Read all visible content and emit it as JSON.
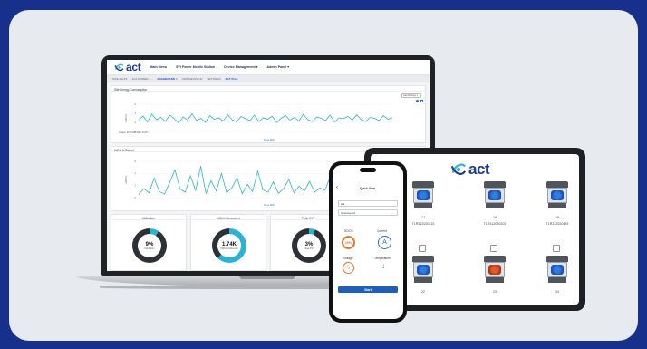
{
  "app": {
    "brand": "act"
  },
  "colors": {
    "background": "#16308c",
    "card": "#e7ebf0",
    "brand_blue": "#1b3b8f",
    "accent": "#2bb3d6",
    "gauge_orange": "#e9742b"
  },
  "laptop": {
    "nav": [
      "Main Menu",
      "SVI Power Mobile Station",
      "Device Management ▾",
      "Admin Panel ▾"
    ],
    "tabs": [
      "SITE-JALP1",
      "AC1 POWER 1...",
      "DASHBOARD ×",
      "UNIT/DEVICE ID",
      "SETTINGS",
      "ACT Prod"
    ],
    "panel1": {
      "title": "Site Energy Consumption",
      "range_label": "Last 30 Days ▾",
      "summary": "Status: 22.5 kWh/day, 8.4% ↑↑",
      "view_more": "View More"
    },
    "panel2": {
      "title": "kWh/Hz Output",
      "view_more": "View More"
    },
    "gauges": [
      {
        "title": "Utilization",
        "value": "9%",
        "label": "Utilization",
        "fraction": 0.09
      },
      {
        "title": "kWh/h Generated",
        "value": "1.74K",
        "label": "kWh/h Delivered",
        "fraction": 0.62
      },
      {
        "title": "Peak KVT",
        "value": "3%",
        "label": "Peak KVT",
        "fraction": 0.03
      }
    ]
  },
  "tablet": {
    "brand": "act",
    "units": [
      {
        "number": "17",
        "serial": "T1R312020415",
        "state": "ok"
      },
      {
        "number": "18",
        "serial": "T1R312020202",
        "state": "ok"
      },
      {
        "number": "19",
        "serial": "T1R312020429",
        "state": "ok"
      },
      {
        "number": "22",
        "serial": "",
        "state": "ok"
      },
      {
        "number": "23",
        "serial": "",
        "state": "error"
      },
      {
        "number": "24",
        "serial": "",
        "state": "ok"
      }
    ]
  },
  "phone": {
    "title": "Quick View",
    "field1": "HS",
    "field2": "Unoccupied",
    "metrics": [
      {
        "label": "SOC%",
        "value": "45%"
      },
      {
        "label": "Current",
        "value": "A"
      },
      {
        "label": "Voltage",
        "value": ""
      },
      {
        "label": "Temperature",
        "value": ""
      }
    ],
    "button": "Start"
  },
  "chart_data": [
    {
      "type": "line",
      "title": "Site Energy Consumption",
      "ylabel": "kWh/hr",
      "ylim": [
        0,
        6
      ],
      "series": [
        {
          "values": [
            2.5,
            3.4,
            2.1,
            3.8,
            2.6,
            3.1,
            2.2,
            3.6,
            2.8,
            1.9,
            3.2,
            2.5,
            3.9,
            2.4,
            2.9,
            2.0,
            3.5,
            2.7,
            3.0,
            2.3,
            3.7,
            2.6,
            2.1,
            3.3,
            2.8,
            2.4,
            3.6,
            2.2,
            3.0,
            2.7,
            3.4,
            2.0,
            2.9,
            3.5,
            2.5,
            3.1,
            2.3,
            3.8,
            2.6,
            2.2,
            3.2,
            2.9,
            2.4,
            3.6,
            2.1,
            3.0,
            2.8,
            3.3,
            2.5,
            3.7,
            2.6,
            2.2,
            3.1,
            2.9,
            2.4,
            3.5,
            2.7,
            3.0
          ]
        }
      ]
    },
    {
      "type": "line",
      "title": "kWh/Hz Output",
      "ylabel": "kWh/hr",
      "ylim": [
        0,
        6
      ],
      "series": [
        {
          "values": [
            0.5,
            1.5,
            0.8,
            3.2,
            1.0,
            0.6,
            2.5,
            4.6,
            1.4,
            0.9,
            3.6,
            1.2,
            5.2,
            0.7,
            2.8,
            1.1,
            4.0,
            0.8,
            1.6,
            3.3,
            0.6,
            2.2,
            1.0,
            4.4,
            1.3,
            0.9,
            2.6,
            0.7,
            1.5,
            3.0,
            0.8,
            1.9,
            1.1,
            2.7,
            0.9,
            1.6,
            1.2,
            3.5,
            0.7,
            2.1,
            1.0,
            1.8,
            0.8,
            2.4,
            1.2,
            0.9,
            1.7,
            1.1,
            2.0,
            0.8
          ]
        }
      ]
    }
  ]
}
